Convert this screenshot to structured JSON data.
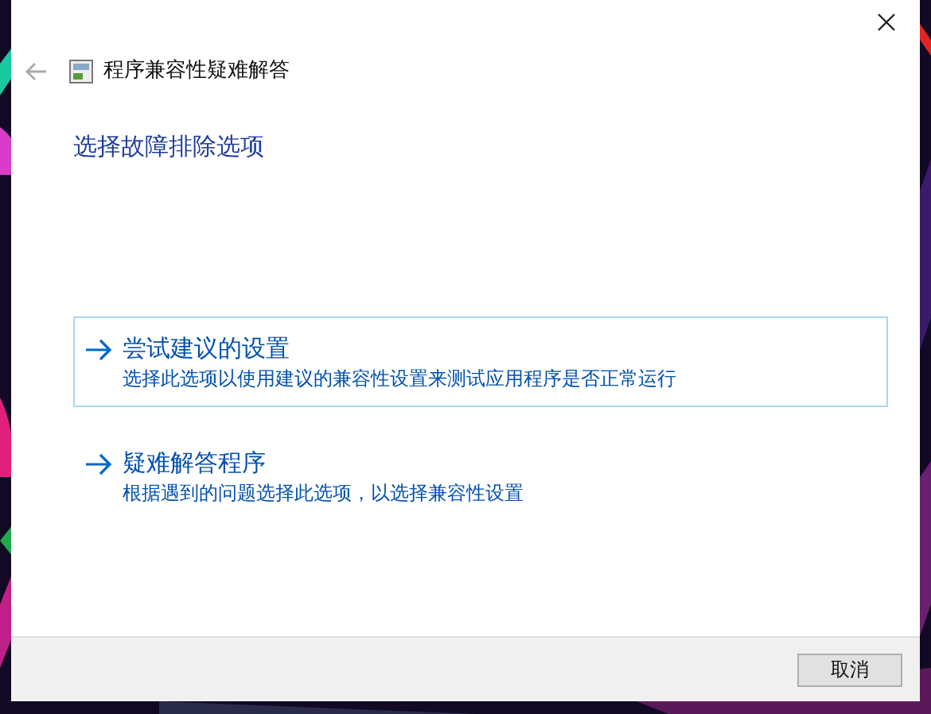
{
  "window": {
    "title": "程序兼容性疑难解答"
  },
  "heading": "选择故障排除选项",
  "options": [
    {
      "title": "尝试建议的设置",
      "description": "选择此选项以使用建议的兼容性设置来测试应用程序是否正常运行",
      "selected": true
    },
    {
      "title": "疑难解答程序",
      "description": "根据遇到的问题选择此选项，以选择兼容性设置",
      "selected": false
    }
  ],
  "buttons": [
    "取消"
  ]
}
